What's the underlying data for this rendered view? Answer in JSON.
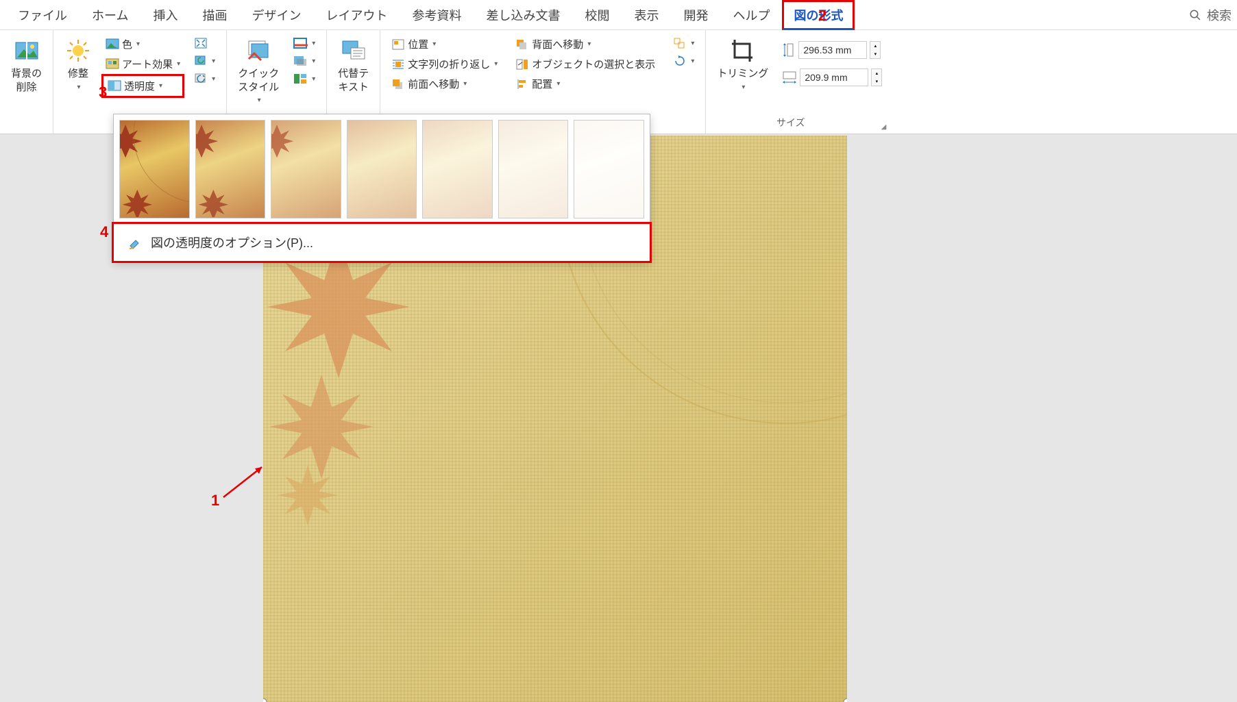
{
  "tabs": {
    "file": "ファイル",
    "home": "ホーム",
    "insert": "挿入",
    "draw": "描画",
    "design": "デザイン",
    "layout": "レイアウト",
    "references": "参考資料",
    "mailings": "差し込み文書",
    "review": "校閲",
    "view": "表示",
    "developer": "開発",
    "help": "ヘルプ",
    "picture_format": "図の形式",
    "search": "検索"
  },
  "ribbon": {
    "remove_bg_l1": "背景の",
    "remove_bg_l2": "削除",
    "corrections": "修整",
    "color": "色",
    "art_effects": "アート効果",
    "transparency": "透明度",
    "quick_styles_l1": "クイック",
    "quick_styles_l2": "スタイル",
    "alt_text_l1": "代替テ",
    "alt_text_l2": "キスト",
    "position": "位置",
    "text_wrap": "文字列の折り返し",
    "bring_forward": "前面へ移動",
    "send_backward": "背面へ移動",
    "selection_pane": "オブジェクトの選択と表示",
    "align": "配置",
    "crop": "トリミング",
    "size_group": "サイズ",
    "height_val": "296.53 mm",
    "width_val": "209.9 mm"
  },
  "gallery": {
    "option_label": "図の透明度のオプション(P)..."
  },
  "annotations": {
    "n1": "1",
    "n2": "2",
    "n3": "3",
    "n4": "4"
  }
}
